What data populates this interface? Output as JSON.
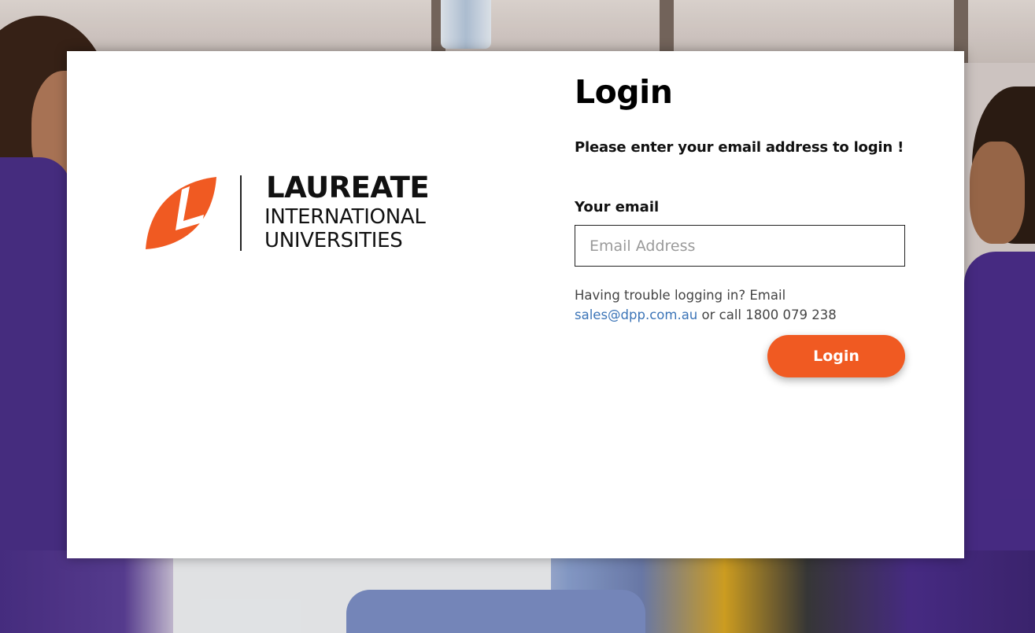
{
  "brand": {
    "logo_main": "LAUREATE",
    "logo_line1": "INTERNATIONAL",
    "logo_line2": "UNIVERSITIES",
    "logo_color": "#f05a22"
  },
  "form": {
    "title": "Login",
    "subtitle": "Please enter your email address to login !",
    "email_label": "Your email",
    "email_placeholder": "Email Address",
    "email_value": "",
    "help_text_prefix": "Having trouble logging in? Email",
    "help_email": "sales@dpp.com.au",
    "help_text_suffix": "or call 1800 079 238",
    "login_button": "Login"
  },
  "colors": {
    "accent": "#f05a22",
    "link": "#3b74b7"
  }
}
